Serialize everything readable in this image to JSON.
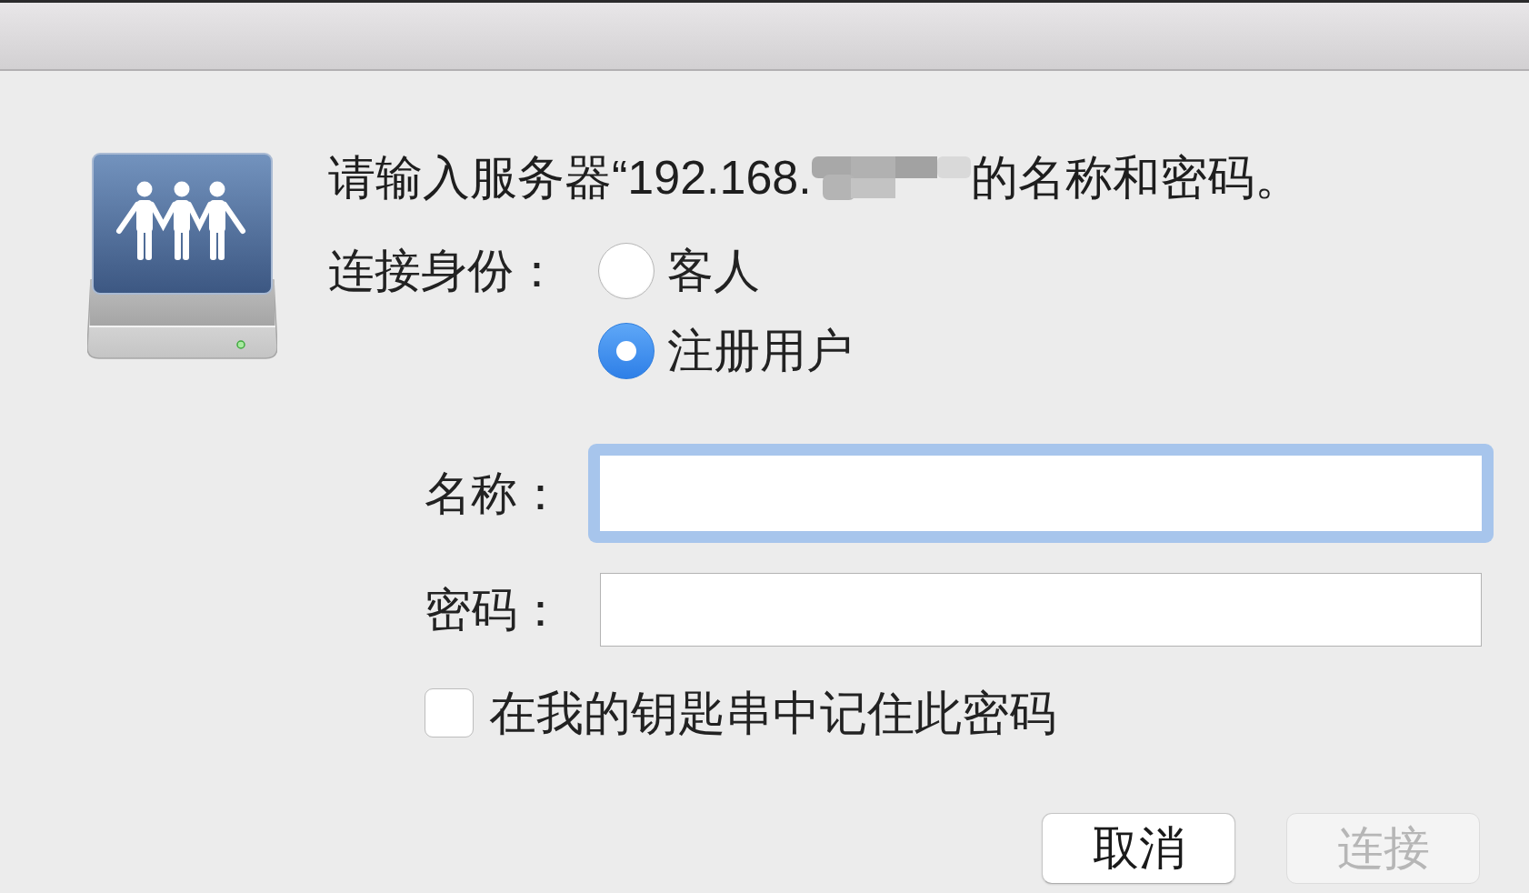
{
  "prompt": {
    "text_before": "请输入服务器“192.168.",
    "redacted": true,
    "text_after": "的名称和密码。"
  },
  "connect_as": {
    "label": "连接身份：",
    "options": [
      {
        "label": "客人",
        "selected": false
      },
      {
        "label": "注册用户",
        "selected": true
      }
    ]
  },
  "fields": [
    {
      "label": "名称：",
      "focused": true
    },
    {
      "label": "密码：",
      "focused": false
    }
  ],
  "remember": {
    "label": "在我的钥匙串中记住此密码",
    "checked": false
  },
  "buttons": [
    {
      "label": "取消",
      "disabled": false
    },
    {
      "label": "连接",
      "disabled": true
    }
  ]
}
